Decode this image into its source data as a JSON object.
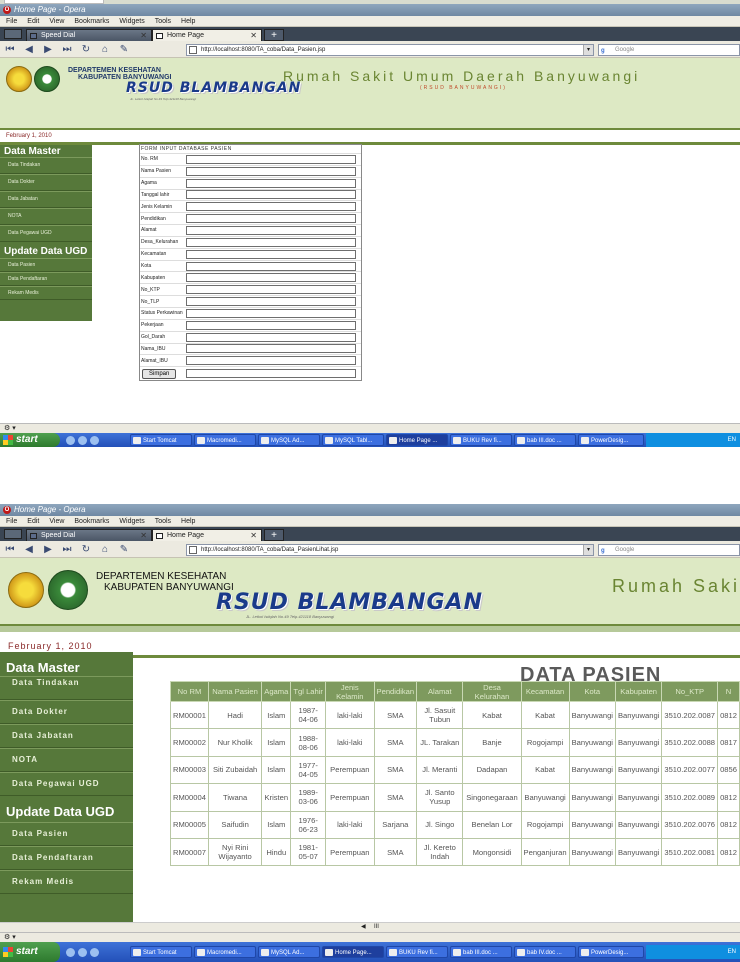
{
  "browser": {
    "window_title": "Home Page - Opera",
    "menu": [
      "File",
      "Edit",
      "View",
      "Bookmarks",
      "Widgets",
      "Tools",
      "Help"
    ],
    "tabs": [
      {
        "label": "Speed Dial"
      },
      {
        "label": "Home Page"
      }
    ],
    "search_placeholder": "Google",
    "url1": "http://localhost:8080/TA_coba/Data_Pasien.jsp",
    "url2": "http://localhost:8080/TA_coba/Data_PasienLihat.jsp"
  },
  "site": {
    "dept_line1": "DEPARTEMEN KESEHATAN",
    "dept_line2": "KABUPATEN BANYUWANGI",
    "logo_text": "RSUD BLAMBANGAN",
    "logo_address": "JL. Letkol Istiqlah No.49 Telp.421118 Banyuwangi",
    "title1": "Rumah Sakit Umum Daerah Banyuwangi",
    "subtitle1": "(RSUD BANYUWANGI)",
    "title2": "Rumah Saki",
    "date": "February 1, 2010"
  },
  "sidebar": {
    "master_heading": "Data Master",
    "master_items": [
      "Data Tindakan",
      "Data Dokter",
      "Data Jabatan",
      "NOTA",
      "Data Pegawai UGD"
    ],
    "ugd_heading": "Update Data UGD",
    "ugd_items": [
      "Data Pasien",
      "Data Pendaftaran",
      "Rekam Medis"
    ]
  },
  "form": {
    "heading": "FORM INPUT DATABASE PASIEN",
    "fields": [
      "No. RM",
      "Nama Pasien",
      "Agama",
      "Tanggal lahir",
      "Jenis Kelamin",
      "Pendidikan",
      "Alamat",
      "Desa_Kelurahan",
      "Kecamatan",
      "Kota",
      "Kabupaten",
      "No_KTP",
      "No_TLP",
      "Status Perkawinan",
      "Pekerjaan",
      "Gol_Darah",
      "Nama_IBU",
      "Alamat_IBU"
    ],
    "submit": "Simpan"
  },
  "table": {
    "title": "DATA PASIEN",
    "headers": [
      "No RM",
      "Nama Pasien",
      "Agama",
      "Tgl Lahir",
      "Jenis Kelamin",
      "Pendidikan",
      "Alamat",
      "Desa Kelurahan",
      "Kecamatan",
      "Kota",
      "Kabupaten",
      "No_KTP",
      "N"
    ],
    "rows": [
      [
        "RM00001",
        "Hadi",
        "Islam",
        "1987-04-06",
        "laki-laki",
        "SMA",
        "Jl. Sasuit Tubun",
        "Kabat",
        "Kabat",
        "Banyuwangi",
        "Banyuwangi",
        "3510.202.0087",
        "0812"
      ],
      [
        "RM00002",
        "Nur Kholik",
        "Islam",
        "1988-08-06",
        "laki-laki",
        "SMA",
        "JL. Tarakan",
        "Banje",
        "Rogojampi",
        "Banyuwangi",
        "Banyuwangi",
        "3510.202.0088",
        "0817"
      ],
      [
        "RM00003",
        "Siti Zubaidah",
        "Islam",
        "1977-04-05",
        "Perempuan",
        "SMA",
        "Jl. Meranti",
        "Dadapan",
        "Kabat",
        "Banyuwangi",
        "Banyuwangi",
        "3510.202.0077",
        "0856"
      ],
      [
        "RM00004",
        "Tiwana",
        "Kristen",
        "1989-03-06",
        "Perempuan",
        "SMA",
        "Jl. Santo Yusup",
        "Singonegaraan",
        "Banyuwangi",
        "Banyuwangi",
        "Banyuwangi",
        "3510.202.0089",
        "0812"
      ],
      [
        "RM00005",
        "Saifudin",
        "Islam",
        "1976-06-23",
        "laki-laki",
        "Sarjana",
        "Jl. Singo",
        "Benelan Lor",
        "Rogojampi",
        "Banyuwangi",
        "Banyuwangi",
        "3510.202.0076",
        "0812"
      ],
      [
        "RM00007",
        "Nyi Rini Wijayanto",
        "Hindu",
        "1981-05-07",
        "Perempuan",
        "SMA",
        "Jl. Kereto Indah",
        "Mongonsidi",
        "Penganjuran",
        "Banyuwangi",
        "Banyuwangi",
        "3510.202.0081",
        "0812"
      ]
    ]
  },
  "taskbar": {
    "start": "start",
    "items": [
      "Start Tomcat",
      "Macromedi...",
      "MySQL Ad...",
      "MySQL Tabl...",
      "Home Page ...",
      "BUKU Rev fi...",
      "bab III.doc ...",
      "PowerDesig..."
    ],
    "items2": [
      "Start Tomcat",
      "Macromedi...",
      "MySQL Ad...",
      "Home Page...",
      "BUKU Rev fi...",
      "bab III.doc ...",
      "bab IV.doc ...",
      "PowerDesig..."
    ],
    "tray": "EN"
  }
}
